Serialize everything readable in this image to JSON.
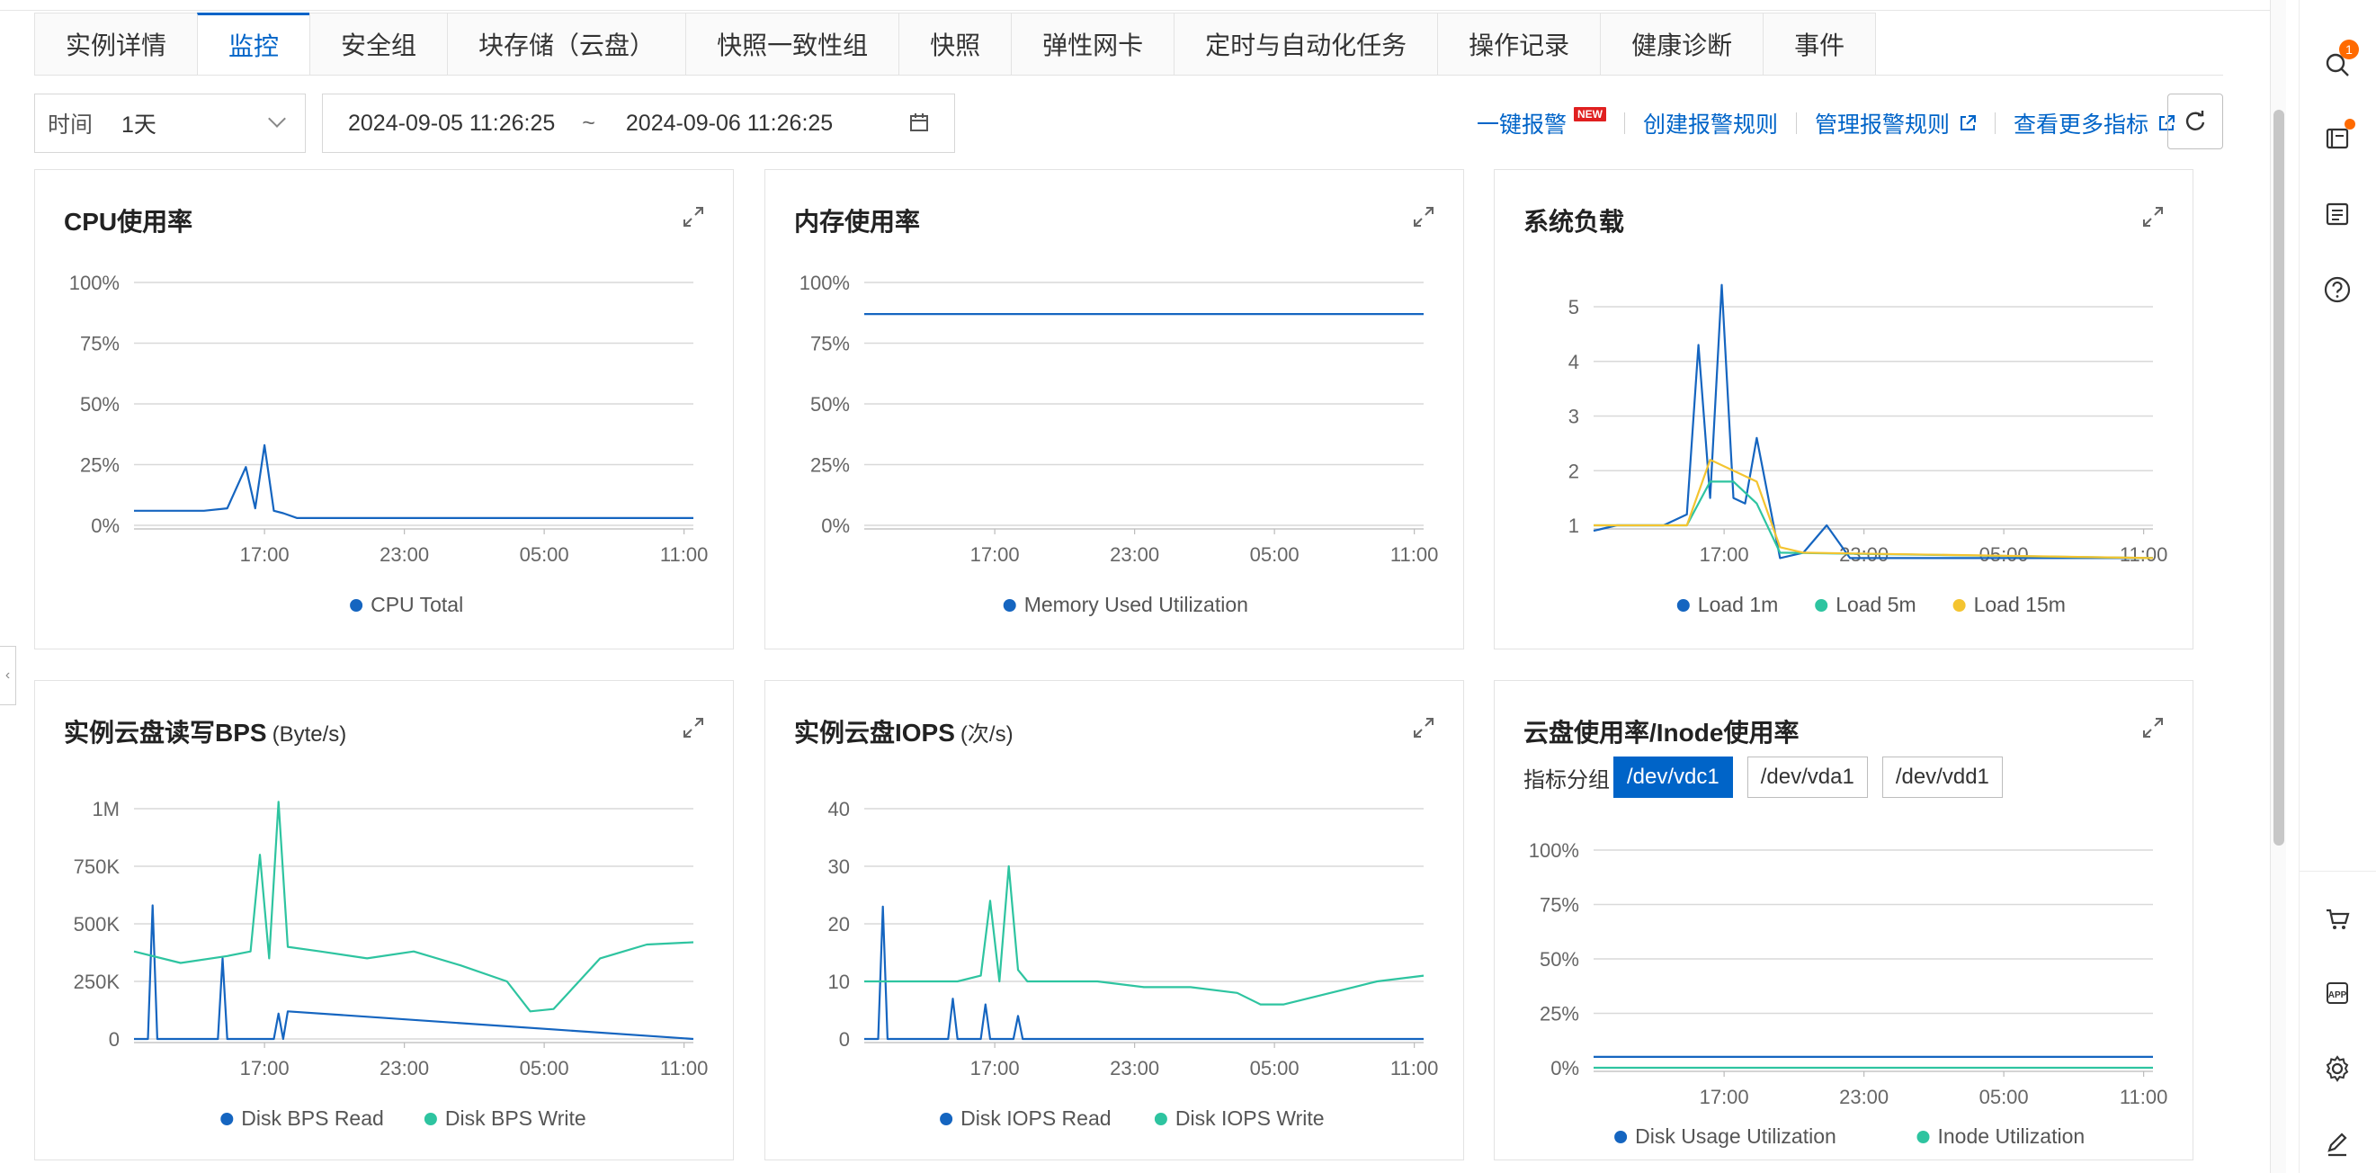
{
  "tabs": [
    {
      "label": "实例详情",
      "active": false
    },
    {
      "label": "监控",
      "active": true
    },
    {
      "label": "安全组",
      "active": false
    },
    {
      "label": "块存储（云盘）",
      "active": false
    },
    {
      "label": "快照一致性组",
      "active": false
    },
    {
      "label": "快照",
      "active": false
    },
    {
      "label": "弹性网卡",
      "active": false
    },
    {
      "label": "定时与自动化任务",
      "active": false
    },
    {
      "label": "操作记录",
      "active": false
    },
    {
      "label": "健康诊断",
      "active": false
    },
    {
      "label": "事件",
      "active": false
    }
  ],
  "toolbar": {
    "time_label": "时间",
    "time_value": "1天",
    "date_start": "2024-09-05 11:26:25",
    "date_sep": "~",
    "date_end": "2024-09-06 11:26:25",
    "one_click_alarm": "一键报警",
    "new_badge": "NEW",
    "create_rule": "创建报警规则",
    "manage_rules": "管理报警规则",
    "more_metrics": "查看更多指标"
  },
  "colors": {
    "accent": "#0064c8",
    "series_blue": "#1565c0",
    "series_green": "#2ec4a0",
    "series_yellow": "#f4c430",
    "badge_orange": "#ff6a00",
    "new_red": "#e02020"
  },
  "sidebar_right": {
    "icons": [
      "search-icon",
      "book-icon",
      "checklist-icon",
      "help-icon",
      "cart-icon",
      "app-icon",
      "gear-icon",
      "edit-icon"
    ],
    "search_badge": "1"
  },
  "chart_data": [
    {
      "id": "cpu",
      "title": "CPU使用率",
      "unit": "",
      "type": "line",
      "y_ticks": [
        "100%",
        "75%",
        "50%",
        "25%",
        "0%"
      ],
      "ylim": [
        0,
        100
      ],
      "x_ticks": [
        "17:00",
        "23:00",
        "05:00",
        "11:00"
      ],
      "legend": [
        "CPU Total"
      ],
      "series": [
        {
          "name": "CPU Total",
          "color": "#1565c0",
          "x": [
            0,
            1,
            2,
            3,
            4,
            4.8,
            5.2,
            5.6,
            6,
            6.4,
            7,
            8,
            9,
            10,
            11,
            12,
            13,
            14,
            15,
            16,
            17,
            18,
            19,
            20,
            21,
            22,
            23,
            24
          ],
          "values": [
            6,
            6,
            6,
            6,
            7,
            24,
            7,
            33,
            6,
            5,
            3,
            3,
            3,
            3,
            3,
            3,
            3,
            3,
            3,
            3,
            3,
            3,
            3,
            3,
            3,
            3,
            3,
            3
          ]
        }
      ]
    },
    {
      "id": "mem",
      "title": "内存使用率",
      "unit": "",
      "type": "line",
      "y_ticks": [
        "100%",
        "75%",
        "50%",
        "25%",
        "0%"
      ],
      "ylim": [
        0,
        100
      ],
      "x_ticks": [
        "17:00",
        "23:00",
        "05:00",
        "11:00"
      ],
      "legend": [
        "Memory Used Utilization"
      ],
      "series": [
        {
          "name": "Memory Used Utilization",
          "color": "#1565c0",
          "x": [
            0,
            6,
            12,
            18,
            24
          ],
          "values": [
            87,
            87,
            87,
            87,
            87
          ]
        }
      ]
    },
    {
      "id": "load",
      "title": "系统负载",
      "unit": "",
      "type": "line",
      "y_ticks": [
        "5",
        "4",
        "3",
        "2",
        "1"
      ],
      "ylim": [
        0,
        5.5
      ],
      "x_ticks": [
        "17:00",
        "23:00",
        "05:00",
        "11:00"
      ],
      "legend": [
        "Load 1m",
        "Load 5m",
        "Load 15m"
      ],
      "series": [
        {
          "name": "Load 1m",
          "color": "#1565c0",
          "x": [
            0,
            1,
            2,
            3,
            4,
            4.5,
            5,
            5.5,
            6,
            6.5,
            7,
            8,
            9,
            10,
            11,
            12,
            13,
            14,
            15,
            16,
            17,
            18,
            19,
            20,
            21,
            22,
            23,
            24
          ],
          "values": [
            0.9,
            1.0,
            1.0,
            1.0,
            1.2,
            4.3,
            1.5,
            5.4,
            1.5,
            1.4,
            2.6,
            0.4,
            0.5,
            1.0,
            0.4,
            0.4,
            0.4,
            0.4,
            0.4,
            0.4,
            0.4,
            0.4,
            0.4,
            0.4,
            0.4,
            0.4,
            0.4,
            0.4
          ]
        },
        {
          "name": "Load 5m",
          "color": "#2ec4a0",
          "x": [
            0,
            4,
            5,
            6,
            7,
            8,
            24
          ],
          "values": [
            1.0,
            1.0,
            1.8,
            1.8,
            1.4,
            0.5,
            0.4
          ]
        },
        {
          "name": "Load 15m",
          "color": "#f4c430",
          "x": [
            0,
            4,
            5,
            6,
            7,
            8,
            9,
            24
          ],
          "values": [
            1.0,
            1.0,
            2.2,
            2.0,
            1.8,
            0.6,
            0.5,
            0.4
          ]
        }
      ]
    },
    {
      "id": "bps",
      "title": "实例云盘读写BPS",
      "unit": "(Byte/s)",
      "type": "line",
      "y_ticks": [
        "1M",
        "750K",
        "500K",
        "250K",
        "0"
      ],
      "ylim": [
        0,
        1000000
      ],
      "x_ticks": [
        "17:00",
        "23:00",
        "05:00",
        "11:00"
      ],
      "legend": [
        "Disk BPS Read",
        "Disk BPS Write"
      ],
      "series": [
        {
          "name": "Disk BPS Read",
          "color": "#1565c0",
          "x": [
            0,
            0.6,
            0.8,
            1,
            3.6,
            3.8,
            4,
            6,
            6.2,
            6.4,
            6.6,
            24
          ],
          "values": [
            0,
            0,
            580000,
            0,
            0,
            350000,
            0,
            0,
            110000,
            0,
            120000,
            0
          ]
        },
        {
          "name": "Disk BPS Write",
          "color": "#2ec4a0",
          "x": [
            0,
            2,
            4,
            5,
            5.4,
            5.8,
            6.2,
            6.6,
            8,
            10,
            12,
            14,
            16,
            17,
            18,
            19,
            20,
            21,
            22,
            24
          ],
          "values": [
            380000,
            330000,
            360000,
            380000,
            800000,
            350000,
            1030000,
            400000,
            380000,
            350000,
            380000,
            320000,
            250000,
            120000,
            130000,
            240000,
            350000,
            380000,
            410000,
            420000
          ]
        }
      ]
    },
    {
      "id": "iops",
      "title": "实例云盘IOPS",
      "unit": "(次/s)",
      "type": "line",
      "y_ticks": [
        "40",
        "30",
        "20",
        "10",
        "0"
      ],
      "ylim": [
        0,
        42
      ],
      "x_ticks": [
        "17:00",
        "23:00",
        "05:00",
        "11:00"
      ],
      "legend": [
        "Disk IOPS Read",
        "Disk IOPS Write"
      ],
      "series": [
        {
          "name": "Disk IOPS Read",
          "color": "#1565c0",
          "x": [
            0,
            0.6,
            0.8,
            1,
            3.6,
            3.8,
            4,
            5,
            5.2,
            5.4,
            6.4,
            6.6,
            6.8,
            24
          ],
          "values": [
            0,
            0,
            23,
            0,
            0,
            7,
            0,
            0,
            6,
            0,
            0,
            4,
            0,
            0
          ]
        },
        {
          "name": "Disk IOPS Write",
          "color": "#2ec4a0",
          "x": [
            0,
            2,
            4,
            5,
            5.4,
            5.8,
            6.2,
            6.6,
            7,
            8,
            10,
            12,
            14,
            16,
            17,
            18,
            19,
            20,
            21,
            22,
            24
          ],
          "values": [
            10,
            10,
            10,
            11,
            24,
            10,
            30,
            12,
            10,
            10,
            10,
            9,
            9,
            8,
            6,
            6,
            7,
            8,
            9,
            10,
            11
          ]
        }
      ]
    },
    {
      "id": "disk",
      "title": "云盘使用率/Inode使用率",
      "unit": "",
      "type": "line",
      "group_label": "指标分组",
      "groups": [
        "/dev/vdc1",
        "/dev/vda1",
        "/dev/vdd1"
      ],
      "active_group": "/dev/vdc1",
      "y_ticks": [
        "100%",
        "75%",
        "50%",
        "25%",
        "0%"
      ],
      "ylim": [
        0,
        100
      ],
      "x_ticks": [
        "17:00",
        "23:00",
        "05:00",
        "11:00"
      ],
      "legend": [
        "Disk Usage Utilization",
        "Inode Utilization"
      ],
      "series": [
        {
          "name": "Disk Usage Utilization",
          "color": "#1565c0",
          "x": [
            0,
            24
          ],
          "values": [
            5,
            5
          ]
        },
        {
          "name": "Inode Utilization",
          "color": "#2ec4a0",
          "x": [
            0,
            24
          ],
          "values": [
            0,
            0
          ]
        }
      ]
    }
  ]
}
